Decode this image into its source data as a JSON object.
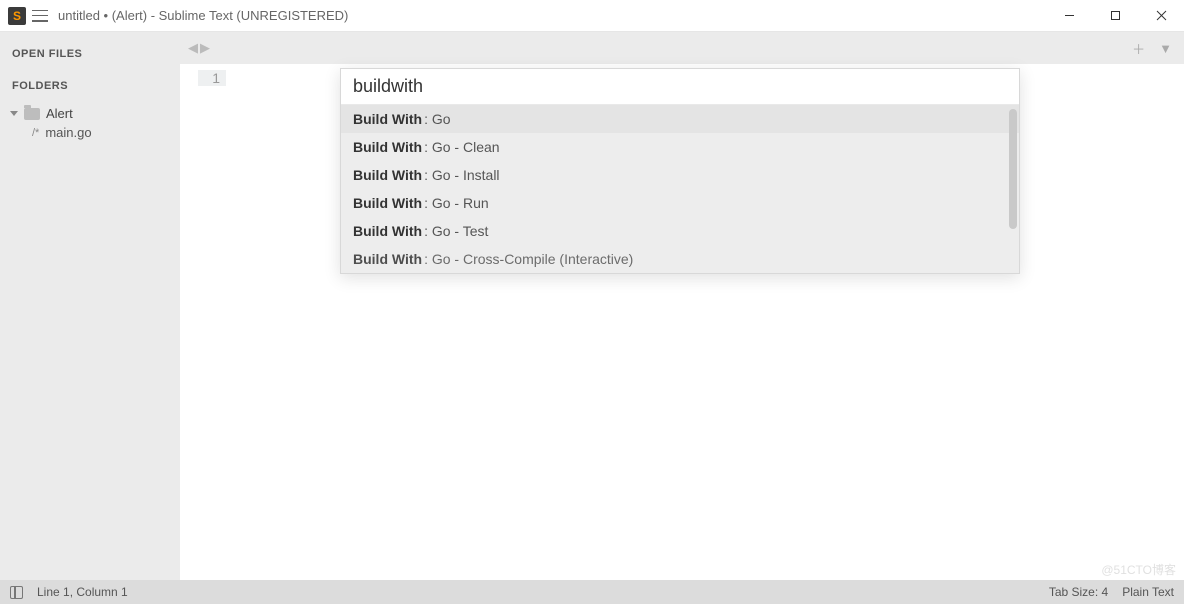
{
  "window": {
    "title": "untitled • (Alert) - Sublime Text (UNREGISTERED)"
  },
  "sidebar": {
    "open_files_label": "OPEN FILES",
    "folders_label": "FOLDERS",
    "root_folder": "Alert",
    "files": [
      {
        "name": "main.go"
      }
    ]
  },
  "editor": {
    "line_numbers": [
      "1"
    ]
  },
  "palette": {
    "query": "buildwith",
    "items": [
      {
        "prefix": "Build With",
        "suffix": ": Go"
      },
      {
        "prefix": "Build With",
        "suffix": ": Go - Clean"
      },
      {
        "prefix": "Build With",
        "suffix": ": Go - Install"
      },
      {
        "prefix": "Build With",
        "suffix": ": Go - Run"
      },
      {
        "prefix": "Build With",
        "suffix": ": Go - Test"
      },
      {
        "prefix": "Build With",
        "suffix": ": Go - Cross-Compile (Interactive)"
      }
    ]
  },
  "statusbar": {
    "position": "Line 1, Column 1",
    "tab_size": "Tab Size: 4",
    "syntax": "Plain Text"
  },
  "watermark": "@51CTO博客"
}
